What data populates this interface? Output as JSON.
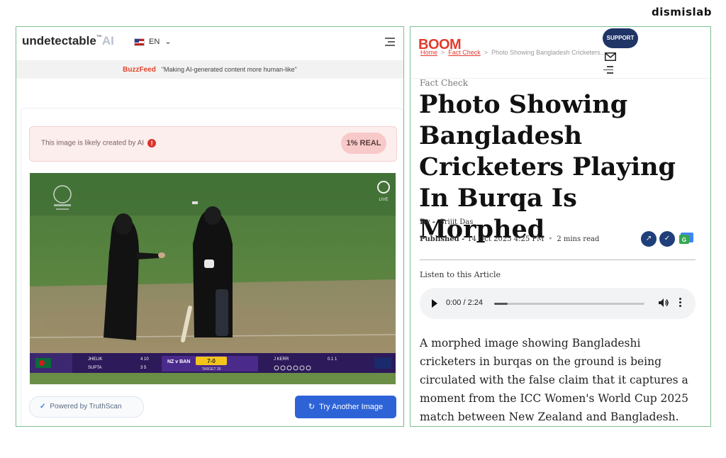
{
  "brand": "dismislab",
  "left_panel": {
    "logo_main": "undetectable",
    "logo_tm": "™",
    "logo_ai": "AI",
    "language": "EN",
    "banner": {
      "brand": "BuzzFeed",
      "quote": "\"Making AI-generated content more human-like\""
    },
    "alert_text": "This image is likely created by AI",
    "alert_icon": "!",
    "real_badge": "1% REAL",
    "scoreboard": {
      "player1": "JHELIK",
      "player1_score": "4 10",
      "player2": "SUPTA",
      "player2_score": "3 5",
      "match": "NZ v BAN",
      "score": "7-0",
      "target": "TARGET 39",
      "bowler": "J KERR",
      "bowler_figs": "0.1 1",
      "live": "LIVE"
    },
    "powered_by": "Powered by TruthScan",
    "try_button": "Try Another Image"
  },
  "right_panel": {
    "logo": "BOOM",
    "breadcrumb": [
      "Home",
      "Fact Check",
      "Photo Showing Bangladesh Cricketers..."
    ],
    "support_button": "SUPPORT",
    "kicker": "Fact Check",
    "headline": "Photo Showing Bangladesh Cricketers Playing In Burqa Is Morphed",
    "by_label": "By -",
    "author": "Srijit Das",
    "published_label": "Published -",
    "published_date": "14 Oct 2025 4:25 PM",
    "read_time": "2 mins read",
    "listen_label": "Listen to this Article",
    "audio_time": "0:00 / 2:24",
    "audio_progress": 0.09,
    "body": "A morphed image showing Bangladeshi cricketers in burqas on the ground is being circulated with the false claim that it captures a moment from the ICC Women's World Cup 2025 match between New Zealand and Bangladesh."
  }
}
